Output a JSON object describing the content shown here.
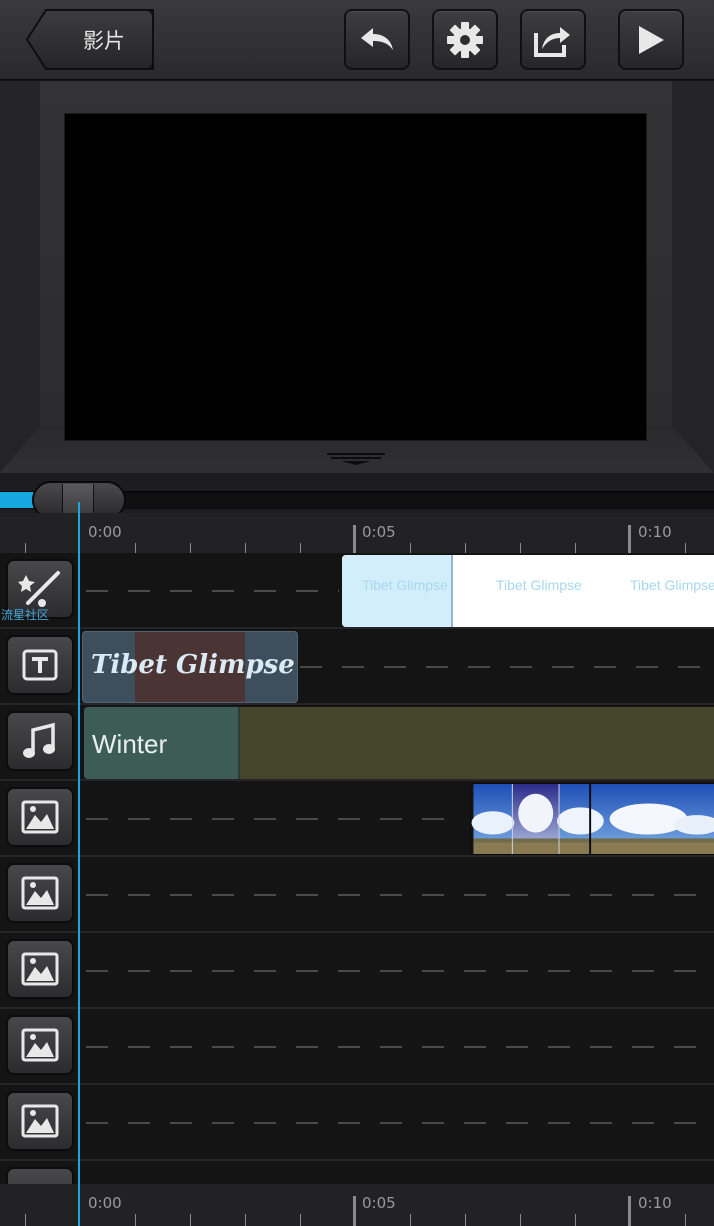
{
  "header": {
    "back_label": "影片",
    "buttons": [
      "undo-icon",
      "gear-icon",
      "share-icon",
      "play-icon"
    ]
  },
  "playback": {
    "position_fraction": 0.05
  },
  "ruler": {
    "labels": [
      "0:00",
      "0:05",
      "0:10"
    ]
  },
  "tracks": {
    "effects": {
      "icon": "magic-wand-icon",
      "label": "流星社区",
      "clip_text": "Tibet Glimpse"
    },
    "title": {
      "icon": "text-icon",
      "clip_text": "Tibet Glimpse"
    },
    "music": {
      "icon": "music-note-icon",
      "clip_text": "Winter"
    },
    "photo_tracks": [
      "image-icon",
      "image-icon",
      "image-icon",
      "image-icon",
      "image-icon"
    ]
  },
  "colors": {
    "accent": "#1aa6de",
    "title_clip": "#3d4f5c",
    "music_clip": "#45452b"
  }
}
